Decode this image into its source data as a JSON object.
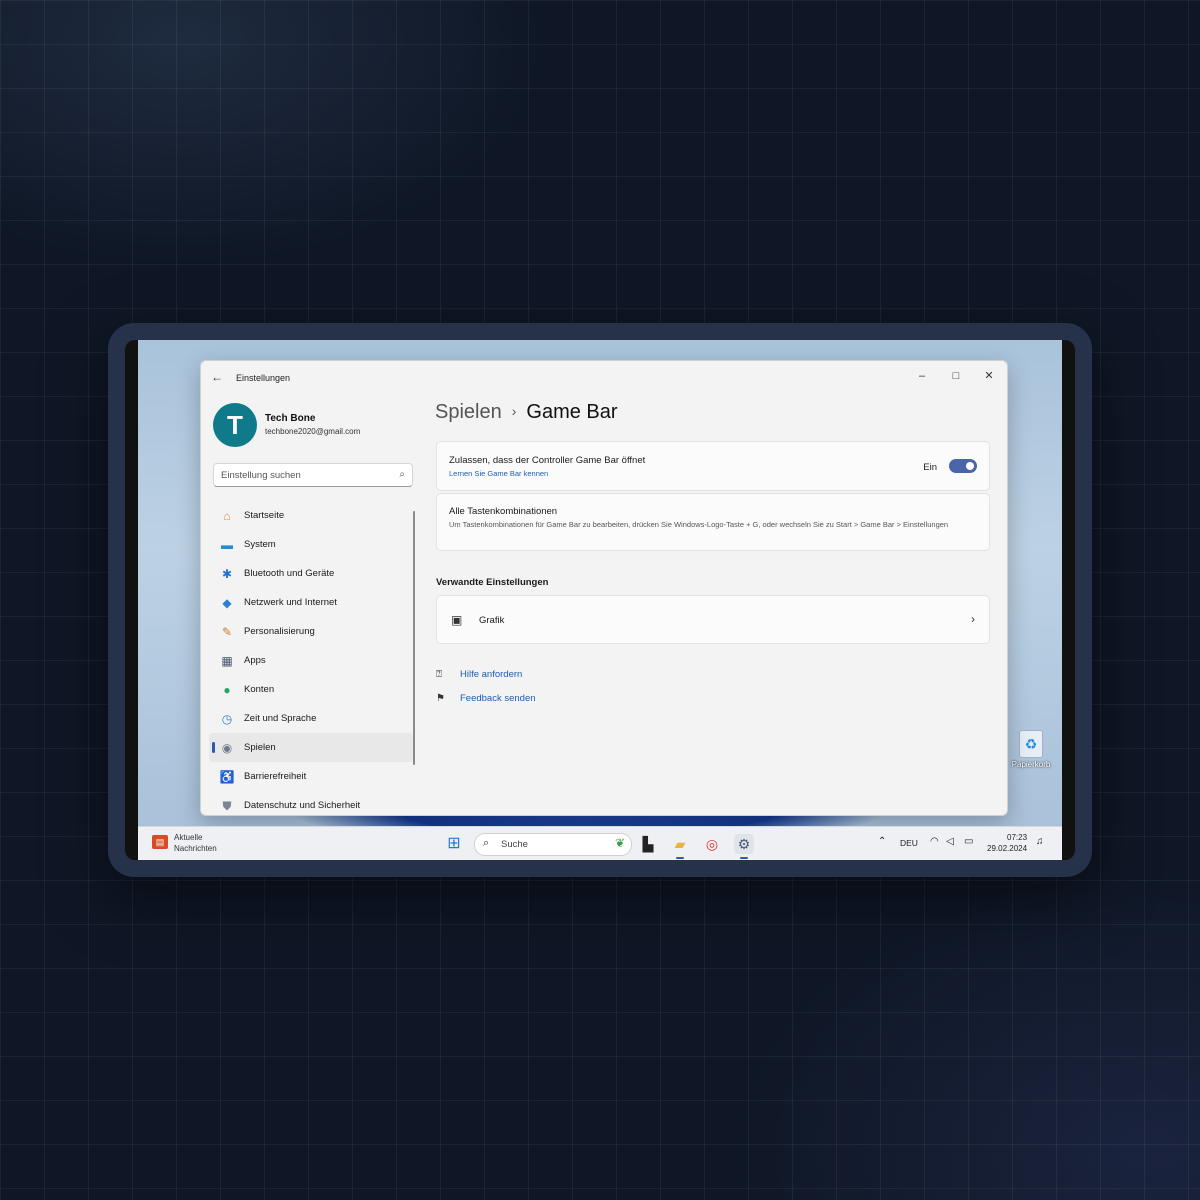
{
  "window": {
    "title": "Einstellungen",
    "controls": {
      "minimize": "–",
      "maximize": "□",
      "close": "✕"
    }
  },
  "profile": {
    "initial": "T",
    "name": "Tech Bone",
    "email": "techbone2020@gmail.com"
  },
  "search": {
    "placeholder": "Einstellung suchen"
  },
  "sidebar": {
    "items": [
      {
        "label": "Startseite",
        "icon": "home-icon",
        "glyph": "⌂",
        "color": "#e8883a"
      },
      {
        "label": "System",
        "icon": "monitor-icon",
        "glyph": "▬",
        "color": "#1e8fd6"
      },
      {
        "label": "Bluetooth und Geräte",
        "icon": "bluetooth-icon",
        "glyph": "✱",
        "color": "#1e73d6"
      },
      {
        "label": "Netzwerk und Internet",
        "icon": "wifi-icon",
        "glyph": "◆",
        "color": "#2a7fd4"
      },
      {
        "label": "Personalisierung",
        "icon": "brush-icon",
        "glyph": "✎",
        "color": "#d07a2e"
      },
      {
        "label": "Apps",
        "icon": "apps-icon",
        "glyph": "▦",
        "color": "#44546a"
      },
      {
        "label": "Konten",
        "icon": "person-icon",
        "glyph": "●",
        "color": "#22a56a"
      },
      {
        "label": "Zeit und Sprache",
        "icon": "globe-clock-icon",
        "glyph": "◷",
        "color": "#2a7fd4"
      },
      {
        "label": "Spielen",
        "icon": "gamepad-icon",
        "glyph": "◉",
        "color": "#6c7a8c"
      },
      {
        "label": "Barrierefreiheit",
        "icon": "accessibility-icon",
        "glyph": "♿",
        "color": "#1e6fd6"
      },
      {
        "label": "Datenschutz und Sicherheit",
        "icon": "shield-icon",
        "glyph": "⛊",
        "color": "#7a8696"
      }
    ],
    "selected": "Spielen"
  },
  "breadcrumb": {
    "parent": "Spielen",
    "separator": "›",
    "current": "Game Bar"
  },
  "settings": {
    "controller": {
      "title": "Zulassen, dass der Controller Game Bar öffnet",
      "link": "Lernen Sie Game Bar kennen",
      "state": "Ein",
      "on": true
    },
    "shortcuts": {
      "title": "Alle Tastenkombinationen",
      "description": "Um Tastenkombinationen für Game Bar zu bearbeiten, drücken Sie Windows-Logo-Taste + G, oder wechseln Sie zu Start > Game Bar > Einstellungen"
    }
  },
  "related": {
    "heading": "Verwandte Einstellungen",
    "graphics": {
      "label": "Grafik",
      "icon": "graphics-card-icon"
    }
  },
  "links": {
    "help": "Hilfe anfordern",
    "feedback": "Feedback senden"
  },
  "desktop": {
    "recycle_label": "Papierkorb"
  },
  "taskbar": {
    "news_line1": "Aktuelle",
    "news_line2": "Nachrichten",
    "search_label": "Suche",
    "language": "DEU",
    "time": "07:23",
    "date": "29.02.2024"
  }
}
